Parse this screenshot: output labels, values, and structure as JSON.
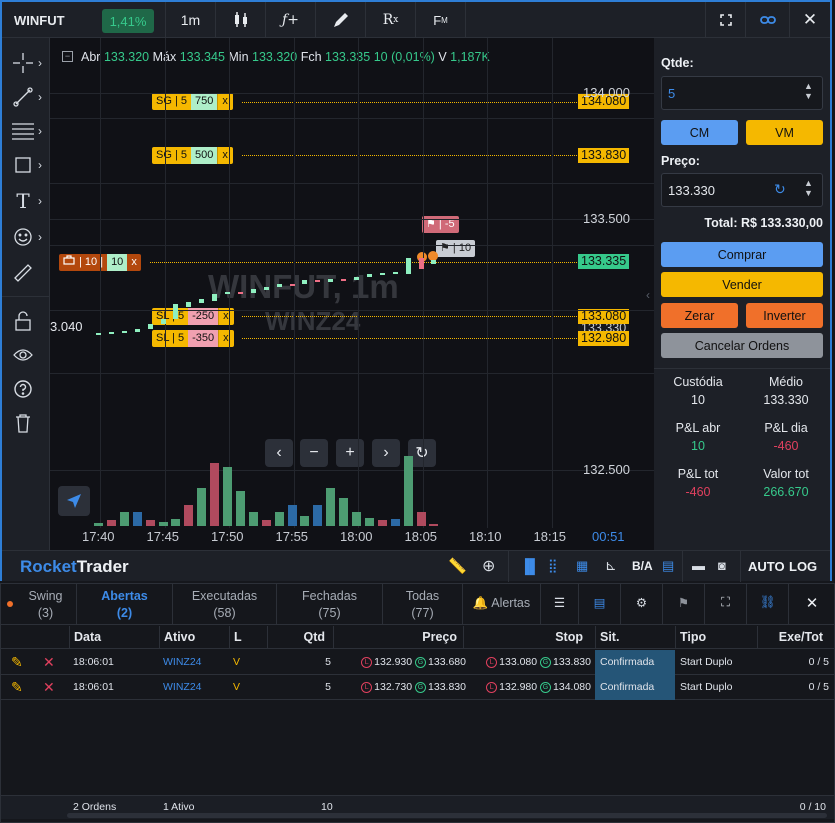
{
  "toolbar": {
    "symbol": "WINFUT",
    "change": "1,41%",
    "timeframe": "1m",
    "icons": [
      "candles-icon",
      "function-icon",
      "pen-icon",
      "rx-icon",
      "fm-icon"
    ]
  },
  "chart_data": {
    "type": "candlestick",
    "title": "WINFUT, 1m",
    "subtitle": "WINZ24",
    "info": {
      "abr_label": "Abr",
      "abr": "133.320",
      "max_label": "Máx",
      "max": "133.345",
      "min_label": "Min",
      "min": "133.320",
      "fch_label": "Fch",
      "fch": "133.335",
      "var": "10 (0,01%)",
      "vol_label": "V",
      "vol": "1,187K"
    },
    "price_ticks": [
      "134.000",
      "133.500",
      "132.500"
    ],
    "price_tick_values": [
      134000,
      133500,
      132500
    ],
    "time_ticks": [
      "17:40",
      "17:45",
      "17:50",
      "17:55",
      "18:00",
      "18:05",
      "18:10",
      "18:15"
    ],
    "countdown": "00:51",
    "y_range": [
      132270,
      134220
    ],
    "last_price": "133.335",
    "left_price": "3.040",
    "candles": [
      {
        "o": 133045,
        "c": 133045,
        "d": "up"
      },
      {
        "o": 133045,
        "c": 133050,
        "d": "up"
      },
      {
        "o": 133048,
        "c": 133055,
        "d": "up"
      },
      {
        "o": 133050,
        "c": 133060,
        "d": "up"
      },
      {
        "o": 133060,
        "c": 133080,
        "d": "up"
      },
      {
        "o": 133080,
        "c": 133100,
        "d": "up"
      },
      {
        "o": 133100,
        "c": 133160,
        "d": "up"
      },
      {
        "o": 133150,
        "c": 133170,
        "d": "up"
      },
      {
        "o": 133165,
        "c": 133180,
        "d": "up"
      },
      {
        "o": 133175,
        "c": 133200,
        "d": "up"
      },
      {
        "o": 133200,
        "c": 133210,
        "d": "up"
      },
      {
        "o": 133210,
        "c": 133205,
        "d": "down"
      },
      {
        "o": 133205,
        "c": 133220,
        "d": "up"
      },
      {
        "o": 133218,
        "c": 133230,
        "d": "up"
      },
      {
        "o": 133228,
        "c": 133240,
        "d": "up"
      },
      {
        "o": 133240,
        "c": 133238,
        "d": "down"
      },
      {
        "o": 133240,
        "c": 133255,
        "d": "up"
      },
      {
        "o": 133255,
        "c": 133250,
        "d": "down"
      },
      {
        "o": 133250,
        "c": 133262,
        "d": "up"
      },
      {
        "o": 133262,
        "c": 133258,
        "d": "down"
      },
      {
        "o": 133258,
        "c": 133270,
        "d": "up"
      },
      {
        "o": 133270,
        "c": 133280,
        "d": "up"
      },
      {
        "o": 133280,
        "c": 133285,
        "d": "up"
      },
      {
        "o": 133285,
        "c": 133290,
        "d": "up"
      },
      {
        "o": 133280,
        "c": 133345,
        "d": "up"
      },
      {
        "o": 133345,
        "c": 133300,
        "d": "down"
      },
      {
        "o": 133320,
        "c": 133335,
        "d": "up"
      }
    ],
    "volumes": [
      {
        "v": 0.05,
        "c": "green"
      },
      {
        "v": 0.08,
        "c": "red"
      },
      {
        "v": 0.2,
        "c": "green"
      },
      {
        "v": 0.2,
        "c": "blue"
      },
      {
        "v": 0.08,
        "c": "red"
      },
      {
        "v": 0.06,
        "c": "green"
      },
      {
        "v": 0.1,
        "c": "green"
      },
      {
        "v": 0.3,
        "c": "red"
      },
      {
        "v": 0.55,
        "c": "green"
      },
      {
        "v": 0.9,
        "c": "red"
      },
      {
        "v": 0.85,
        "c": "green"
      },
      {
        "v": 0.5,
        "c": "green"
      },
      {
        "v": 0.2,
        "c": "green"
      },
      {
        "v": 0.08,
        "c": "red"
      },
      {
        "v": 0.2,
        "c": "green"
      },
      {
        "v": 0.3,
        "c": "blue"
      },
      {
        "v": 0.15,
        "c": "green"
      },
      {
        "v": 0.3,
        "c": "blue"
      },
      {
        "v": 0.55,
        "c": "green"
      },
      {
        "v": 0.4,
        "c": "green"
      },
      {
        "v": 0.2,
        "c": "green"
      },
      {
        "v": 0.12,
        "c": "green"
      },
      {
        "v": 0.08,
        "c": "red"
      },
      {
        "v": 0.1,
        "c": "blue"
      },
      {
        "v": 1.0,
        "c": "green"
      },
      {
        "v": 0.2,
        "c": "red"
      },
      {
        "v": 0.03,
        "c": "red"
      }
    ]
  },
  "orders": {
    "sg1": {
      "label": "SG | 5",
      "value": "750",
      "price": "134.080",
      "x": "x"
    },
    "sg2": {
      "label": "SG | 5",
      "value": "500",
      "price": "133.830",
      "x": "x"
    },
    "pos": {
      "label": "| 10 |",
      "value": "10",
      "x": "x"
    },
    "sl1": {
      "label": "SL | 5",
      "value": "-250",
      "price": "133.080",
      "x": "x"
    },
    "sl2": {
      "label": "SL | 5",
      "value": "-350",
      "price": "132.980",
      "x": "x"
    },
    "hidden_price": "133.330",
    "flag1": "-5",
    "flag2": "10"
  },
  "order_panel": {
    "qty_label": "Qtde:",
    "qty": "5",
    "cm": "CM",
    "vm": "VM",
    "price_label": "Preço:",
    "price": "133.330",
    "total": "Total: R$ 133.330,00",
    "buy": "Comprar",
    "sell": "Vender",
    "zero": "Zerar",
    "invert": "Inverter",
    "cancel": "Cancelar Ordens",
    "stats": [
      {
        "label": "Custódia",
        "value": "10",
        "color": "#e4e7ec"
      },
      {
        "label": "Médio",
        "value": "133.330",
        "color": "#e4e7ec"
      },
      {
        "label": "P&L abr",
        "value": "10",
        "color": "#36c98b"
      },
      {
        "label": "P&L dia",
        "value": "-460",
        "color": "#e0405e"
      },
      {
        "label": "P&L tot",
        "value": "-460",
        "color": "#e0405e"
      },
      {
        "label": "Valor tot",
        "value": "266.670",
        "color": "#36c98b"
      }
    ]
  },
  "brand": {
    "rocket": "Rocket",
    "trader": "Trader"
  },
  "bottombar": {
    "ba": "B/A",
    "auto": "AUTO",
    "log": "LOG"
  },
  "tabs": [
    {
      "label": "Swing",
      "count": "(3)"
    },
    {
      "label": "Abertas",
      "count": "(2)"
    },
    {
      "label": "Executadas",
      "count": "(58)"
    },
    {
      "label": "Fechadas",
      "count": "(75)"
    },
    {
      "label": "Todas",
      "count": "(77)"
    }
  ],
  "alerts_label": "Alertas",
  "columns": [
    "Data",
    "Ativo",
    "L",
    "Qtd",
    "Preço",
    "Stop",
    "Sit.",
    "Tipo",
    "Exe/Tot"
  ],
  "rows": [
    {
      "data": "18:06:01",
      "ativo": "WINZ24",
      "l": "V",
      "qtd": "5",
      "p1": "132.930",
      "p2": "133.680",
      "s1": "133.080",
      "s2": "133.830",
      "sit": "Confirmada",
      "tipo": "Start Duplo",
      "exe": "0 / 5"
    },
    {
      "data": "18:06:01",
      "ativo": "WINZ24",
      "l": "V",
      "qtd": "5",
      "p1": "132.730",
      "p2": "133.830",
      "s1": "132.980",
      "s2": "134.080",
      "sit": "Confirmada",
      "tipo": "Start Duplo",
      "exe": "0 / 5"
    }
  ],
  "footer": {
    "orders": "2 Ordens",
    "assets": "1 Ativo",
    "qty": "10",
    "exe": "0 / 10"
  }
}
